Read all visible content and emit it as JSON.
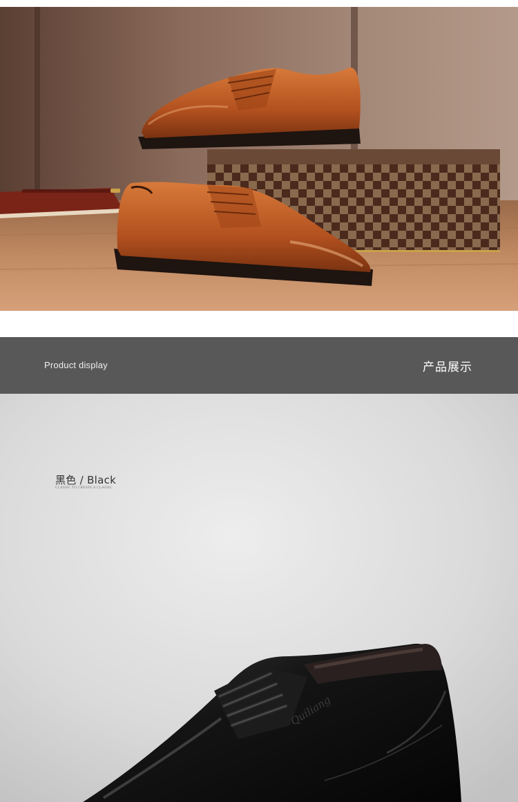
{
  "banner": {
    "label_en": "Product display",
    "label_cn": "产品展示"
  },
  "product_color": {
    "title": "黑色 / Black",
    "tagline": "CLASSIC TO CREATE A CLASSIC"
  },
  "shoe_logo_text": "Quiliang",
  "colors": {
    "banner_bg": "#585858",
    "brown_leather": "#b3511f",
    "black_leather": "#111111",
    "product_bg": "#dcdcdc"
  }
}
